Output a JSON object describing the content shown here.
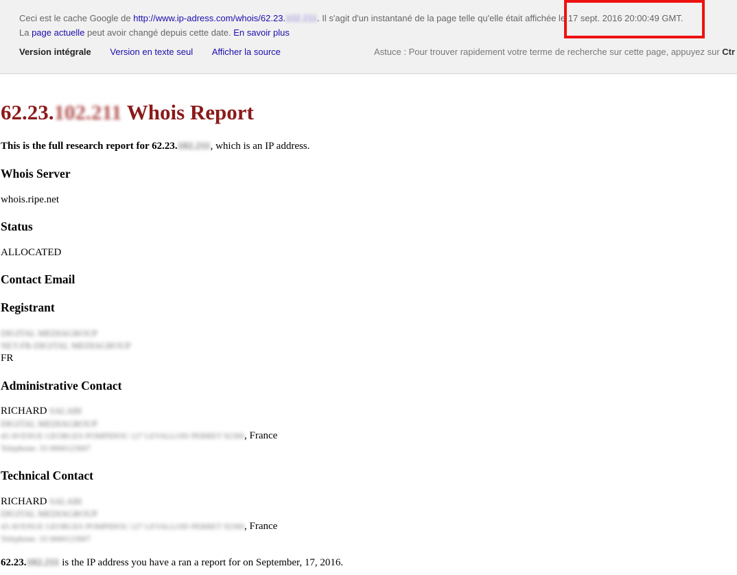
{
  "cache": {
    "prefix": "Ceci est le cache Google de ",
    "url_visible": "http://www.ip-adress.com/whois/62.23.",
    "url_redacted": "102.211",
    "middle": ". Il s'agit d'un instantané de la page telle qu'elle était affichée le ",
    "date": "17 sept. 2016 20:00:49 GMT.",
    "line2_prefix": "La ",
    "current_page_link": "page actuelle",
    "line2_middle": " peut avoir changé depuis cette date. ",
    "learn_more": "En savoir plus",
    "nav": {
      "full": "Version intégrale",
      "text_only": "Version en texte seul",
      "source": "Afficher la source"
    },
    "tip_text": "Astuce : Pour trouver rapidement votre terme de recherche sur cette page, appuyez sur ",
    "tip_key": "Ctr"
  },
  "report": {
    "title_prefix": "62.23.",
    "title_redacted": "102.211",
    "title_suffix": " Whois Report",
    "intro_bold": "This is the full research report for 62.23.",
    "intro_redacted": "102.211",
    "intro_rest": ", which is an IP address.",
    "whois_server_heading": "Whois Server",
    "whois_server_value": "whois.ripe.net",
    "status_heading": "Status",
    "status_value": "ALLOCATED",
    "contact_email_heading": "Contact Email",
    "registrant_heading": "Registrant",
    "registrant_line1_redacted": "DIGITAL MEDIAGROUP",
    "registrant_line2_redacted": "NET-FR-DIGITAL MEDIAGROUP",
    "registrant_country": "FR",
    "admin_heading": "Administrative Contact",
    "admin_first": "RICHARD ",
    "admin_last_redacted": "SALABI",
    "admin_org_redacted": "DIGITAL MEDIAGROUP",
    "admin_address_redacted": "43 AVENUE GEORGES POMPIDOU 127 LEVALLOIS PERRET 92300",
    "admin_country": ", France",
    "admin_phone_redacted": "Telephone: 33 0000123007",
    "tech_heading": "Technical Contact",
    "tech_first": "RICHARD ",
    "tech_last_redacted": "SALABI",
    "tech_org_redacted": "DIGITAL MEDIAGROUP",
    "tech_address_redacted": "43 AVENUE GEORGES POMPIDOU 127 LEVALLOIS PERRET 92300",
    "tech_country": ", France",
    "tech_phone_redacted": "Telephone: 33 0000123007",
    "footer_bold": "62.23.",
    "footer_redacted": "102.211",
    "footer_rest": " is the IP address you have a ran a report for on September, 17, 2016."
  },
  "colors": {
    "title": "#8b1a1a",
    "link": "#1a0dab",
    "highlight": "#ee1111",
    "banner_bg": "#f1f1f1"
  }
}
